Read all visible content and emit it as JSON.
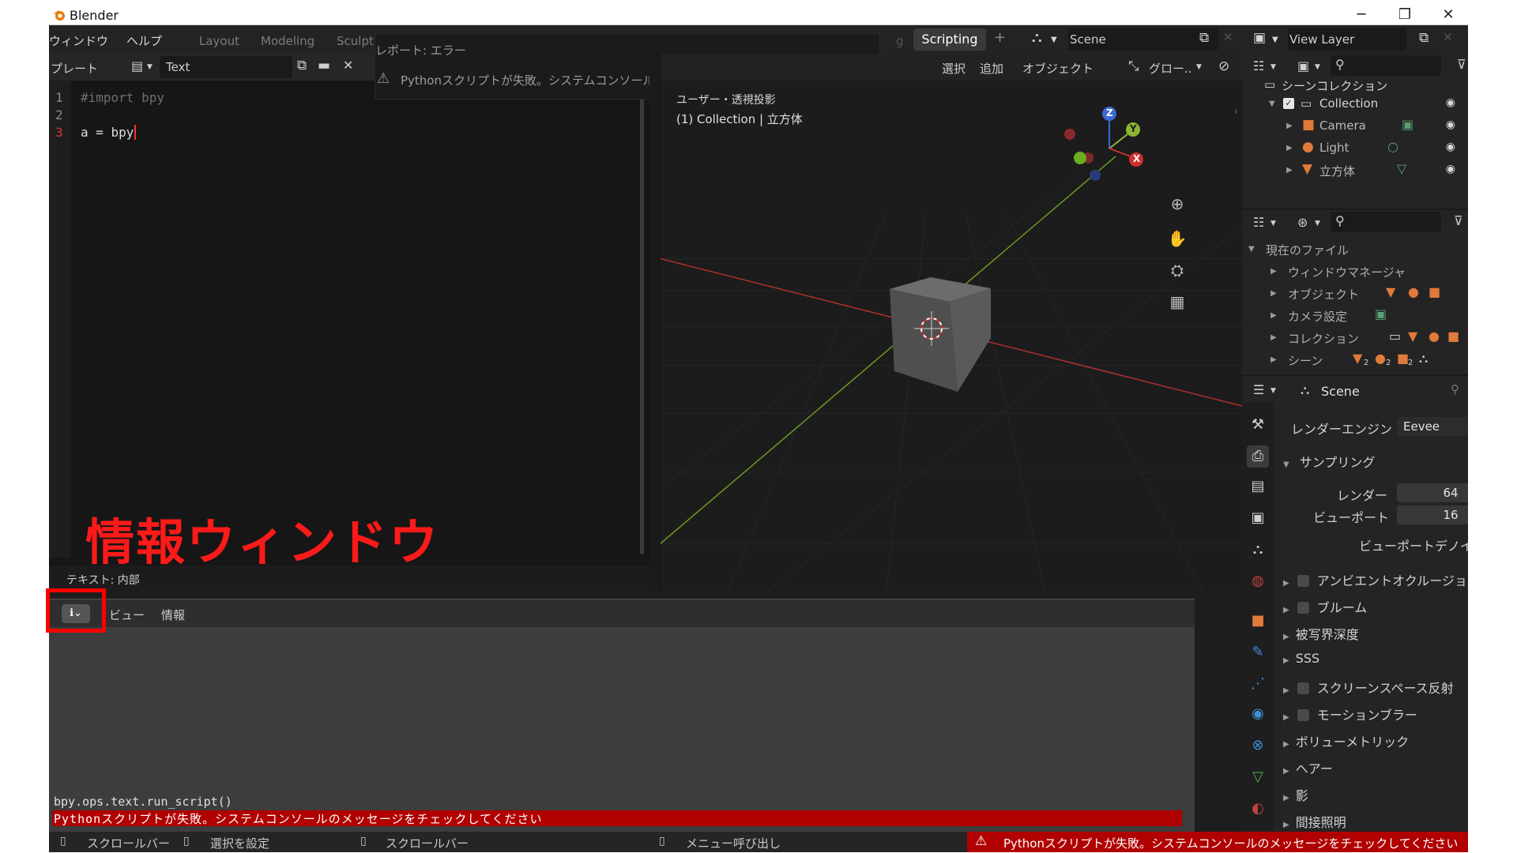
{
  "window": {
    "title": "Blender",
    "controls": {
      "minimize": "─",
      "maximize": "❐",
      "close": "✕"
    }
  },
  "topbar": {
    "menus": [
      "ウィンドウ",
      "ヘルプ"
    ],
    "workspace_tabs": [
      "Layout",
      "Modeling",
      "Sculpt"
    ],
    "active_workspace": "Scripting",
    "add_tab": "+",
    "scene_name": "Scene",
    "view_layer": "View Layer"
  },
  "text_editor": {
    "header": {
      "menu_partial": "プレート",
      "datablock_name": "Text"
    },
    "lines": [
      {
        "num": "1",
        "text": "#import bpy"
      },
      {
        "num": "2",
        "text": ""
      },
      {
        "num": "3",
        "text": "a = bpy"
      }
    ],
    "footer": "テキスト: 内部"
  },
  "report_popup": {
    "title": "レポート: エラー",
    "message": "Pythonスクリプトが失敗。システムコンソールのメッセージをチェックしてください"
  },
  "viewport": {
    "header_menus": [
      "選択",
      "追加",
      "オブジェクト"
    ],
    "transform_orientation": "グロー..",
    "view_label": "ユーザー・透視投影",
    "collection_label": "(1) Collection | 立方体",
    "gizmo_axes": {
      "z": "Z",
      "y": "Y",
      "x": "X"
    },
    "tool_icons": [
      "zoom-icon",
      "hand-icon",
      "camera-icon",
      "grid-icon"
    ],
    "colors": {
      "x_axis": "#b03030",
      "y_axis": "#6a9a20",
      "cube": "#5a5a5a"
    }
  },
  "outliner": {
    "root": "シーンコレクション",
    "collection": "Collection",
    "objects": [
      "Camera",
      "Light",
      "立方体"
    ]
  },
  "file_browser": {
    "root": "現在のファイル",
    "items": [
      "ウィンドウマネージャ",
      "オブジェクト",
      "カメラ設定",
      "コレクション",
      "シーン"
    ],
    "badge_counts": [
      "2",
      "2",
      "2"
    ]
  },
  "properties": {
    "scene_name": "Scene",
    "render_engine_label": "レンダーエンジン",
    "render_engine_value": "Eevee",
    "sampling": {
      "title": "サンプリング",
      "render_label": "レンダー",
      "render_value": "64",
      "viewport_label": "ビューポート",
      "viewport_value": "16",
      "denoise_label": "ビューポートデノイズ",
      "denoise_checked": "✓"
    },
    "panels": [
      "アンビエントオクルージョン(A",
      "ブルーム",
      "被写界深度",
      "SSS",
      "スクリーンスペース反射",
      "モーションブラー",
      "ボリューメトリック",
      "ヘアー",
      "影",
      "間接照明"
    ]
  },
  "info_editor": {
    "header_menus": [
      "ビュー",
      "情報"
    ],
    "log_command": "bpy.ops.text.run_script()",
    "log_error": "Pythonスクリプトが失敗。システムコンソールのメッセージをチェックしてください"
  },
  "statusbar": {
    "items": [
      "スクロールバー",
      "選択を設定",
      "スクロールバー",
      "メニュー呼び出し"
    ],
    "error": "Pythonスクリプトが失敗。システムコンソールのメッセージをチェックしてください"
  },
  "annotation": {
    "label": "情報ウィンドウ",
    "color": "#ff0000"
  }
}
